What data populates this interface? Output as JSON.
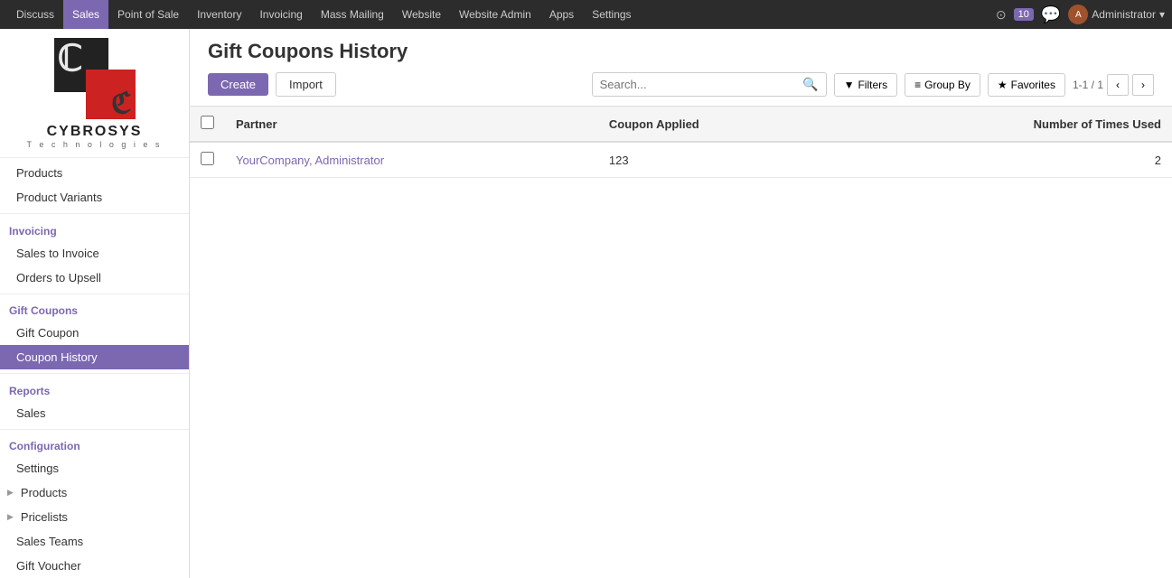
{
  "topnav": {
    "items": [
      {
        "label": "Discuss",
        "active": false
      },
      {
        "label": "Sales",
        "active": true
      },
      {
        "label": "Point of Sale",
        "active": false
      },
      {
        "label": "Inventory",
        "active": false
      },
      {
        "label": "Invoicing",
        "active": false
      },
      {
        "label": "Mass Mailing",
        "active": false
      },
      {
        "label": "Website",
        "active": false
      },
      {
        "label": "Website Admin",
        "active": false
      },
      {
        "label": "Apps",
        "active": false
      },
      {
        "label": "Settings",
        "active": false
      }
    ],
    "badge_count": "10",
    "admin_label": "Administrator"
  },
  "sidebar": {
    "brand_name": "CYBROSYS",
    "brand_sub": "T e c h n o l o g i e s",
    "sections": [
      {
        "label": "",
        "items": [
          {
            "label": "Products",
            "active": false,
            "arrow": false
          },
          {
            "label": "Product Variants",
            "active": false,
            "arrow": false
          }
        ]
      },
      {
        "label": "Invoicing",
        "items": [
          {
            "label": "Sales to Invoice",
            "active": false,
            "arrow": false
          },
          {
            "label": "Orders to Upsell",
            "active": false,
            "arrow": false
          }
        ]
      },
      {
        "label": "Gift Coupons",
        "items": [
          {
            "label": "Gift Coupon",
            "active": false,
            "arrow": false
          },
          {
            "label": "Coupon History",
            "active": true,
            "arrow": false
          }
        ]
      },
      {
        "label": "Reports",
        "items": [
          {
            "label": "Sales",
            "active": false,
            "arrow": false
          }
        ]
      },
      {
        "label": "Configuration",
        "items": [
          {
            "label": "Settings",
            "active": false,
            "arrow": false
          },
          {
            "label": "Products",
            "active": false,
            "arrow": true
          },
          {
            "label": "Pricelists",
            "active": false,
            "arrow": true
          },
          {
            "label": "Sales Teams",
            "active": false,
            "arrow": false
          },
          {
            "label": "Gift Voucher",
            "active": false,
            "arrow": false
          }
        ]
      }
    ]
  },
  "page": {
    "title": "Gift Coupons History",
    "toolbar": {
      "create_label": "Create",
      "import_label": "Import",
      "search_placeholder": "Search...",
      "filters_label": "Filters",
      "group_by_label": "Group By",
      "favorites_label": "Favorites",
      "pagination": "1-1 / 1"
    },
    "table": {
      "columns": [
        "",
        "Partner",
        "Coupon Applied",
        "Number of Times Used"
      ],
      "rows": [
        {
          "partner": "YourCompany, Administrator",
          "coupon_applied": "123",
          "times_used": "2"
        }
      ]
    }
  }
}
